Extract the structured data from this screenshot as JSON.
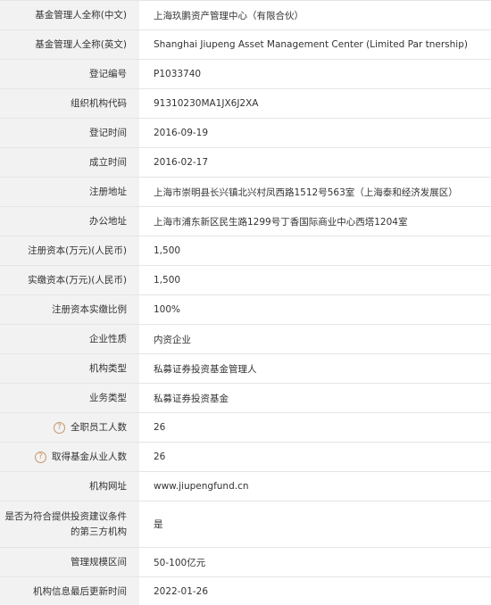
{
  "rows": [
    {
      "label": "基金管理人全称(中文)",
      "value": "上海玖鹏资产管理中心（有限合伙）"
    },
    {
      "label": "基金管理人全称(英文)",
      "value": "Shanghai Jiupeng Asset Management Center (Limited Par tnership)"
    },
    {
      "label": "登记编号",
      "value": "P1033740"
    },
    {
      "label": "组织机构代码",
      "value": "91310230MA1JX6J2XA"
    },
    {
      "label": "登记时间",
      "value": "2016-09-19"
    },
    {
      "label": "成立时间",
      "value": "2016-02-17"
    },
    {
      "label": "注册地址",
      "value": "上海市崇明县长兴镇北兴村凤西路1512号563室（上海泰和经济发展区）"
    },
    {
      "label": "办公地址",
      "value": "上海市浦东新区民生路1299号丁香国际商业中心西塔1204室"
    },
    {
      "label": "注册资本(万元)(人民币)",
      "value": "1,500"
    },
    {
      "label": "实缴资本(万元)(人民币)",
      "value": "1,500"
    },
    {
      "label": "注册资本实缴比例",
      "value": "100%"
    },
    {
      "label": "企业性质",
      "value": "内资企业"
    },
    {
      "label": "机构类型",
      "value": "私募证券投资基金管理人"
    },
    {
      "label": "业务类型",
      "value": "私募证券投资基金"
    },
    {
      "label": "全职员工人数",
      "value": "26",
      "help_icon": "?"
    },
    {
      "label": "取得基金从业人数",
      "value": "26",
      "help_icon": "?"
    },
    {
      "label": "机构网址",
      "value": "www.jiupengfund.cn"
    },
    {
      "label_line1": "是否为符合提供投资建议条件",
      "label_line2": "的第三方机构",
      "value": "是"
    },
    {
      "label": "管理规模区间",
      "value": "50-100亿元"
    },
    {
      "label": "机构信息最后更新时间",
      "value": "2022-01-26"
    }
  ]
}
